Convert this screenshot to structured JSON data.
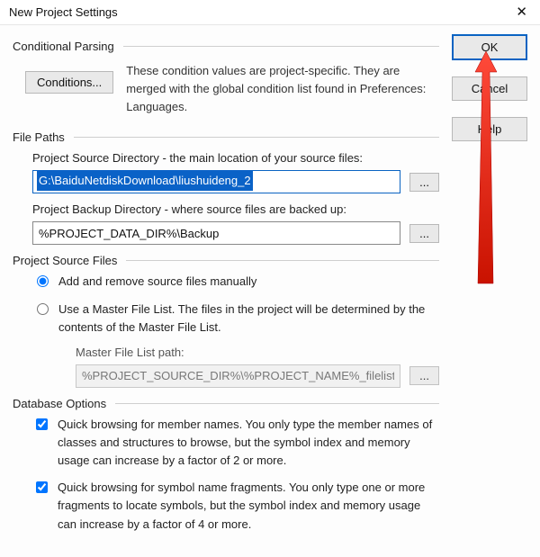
{
  "titlebar": {
    "title": "New Project Settings"
  },
  "buttons": {
    "ok": "OK",
    "cancel": "Cancel",
    "help": "Help",
    "conditions": "Conditions...",
    "browse": "..."
  },
  "groups": {
    "conditional": {
      "header": "Conditional Parsing",
      "desc": "These condition values are project-specific.  They are merged with the global condition list found in Preferences: Languages."
    },
    "filepaths": {
      "header": "File Paths",
      "srcLabel": "Project Source Directory - the main location of your source files:",
      "srcValue": "G:\\BaiduNetdiskDownload\\liushuideng_2",
      "bakLabel": "Project Backup Directory - where source files are backed up:",
      "bakValue": "%PROJECT_DATA_DIR%\\Backup"
    },
    "sourcefiles": {
      "header": "Project Source Files",
      "opt1": "Add and remove source files manually",
      "opt2": "Use a Master File List. The files in the project will be determined by the contents of the Master File List.",
      "mflLabel": "Master File List path:",
      "mflValue": "%PROJECT_SOURCE_DIR%\\%PROJECT_NAME%_filelist.txt"
    },
    "dbopts": {
      "header": "Database Options",
      "chk1": "Quick browsing for member names.  You only type the member names of classes and structures to browse, but the symbol index and memory usage can increase by a factor of 2 or more.",
      "chk2": "Quick browsing for symbol name fragments.  You only type one or more fragments to locate symbols, but the symbol index and memory usage can increase by a factor of 4 or more."
    }
  }
}
